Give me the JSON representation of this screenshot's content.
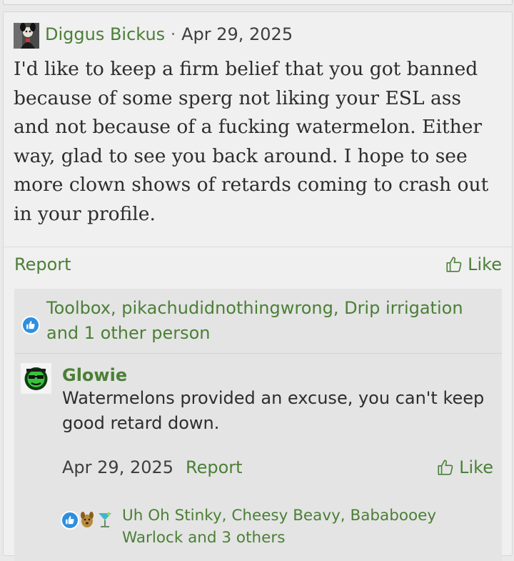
{
  "post": {
    "username": "Diggus Bickus",
    "separator": " · ",
    "date": "Apr 29, 2025",
    "body": "I'd like to keep a firm belief that you got banned because of some sperg not liking your ESL ass and not because of a fucking watermelon. Either way, glad to see you back around. I hope to see more clown shows of retards coming to crash out in your profile.",
    "report_label": "Report",
    "like_label": "Like",
    "reactions_text": "Toolbox, pikachudidnothingwrong, Drip irrigation and 1 other person"
  },
  "reply": {
    "username": "Glowie",
    "body": "Watermelons provided an excuse, you can't keep good retard down.",
    "date": "Apr 29, 2025",
    "report_label": "Report",
    "like_label": "Like",
    "reactions_text": "Uh Oh Stinky, Cheesy Beavy, Bababooey Warlock and 3 others"
  },
  "icons": {
    "like": "thumbs-up-outline-icon",
    "reaction_like": "blue-thumbs-up-icon",
    "reaction_dog": "dog-emoji-icon",
    "reaction_drink": "cocktail-glass-icon"
  },
  "colors": {
    "accent": "#4b7f36",
    "like_blue": "#2e8fe0",
    "text": "#2d2d2d",
    "card_bg": "#f0f0f0"
  }
}
